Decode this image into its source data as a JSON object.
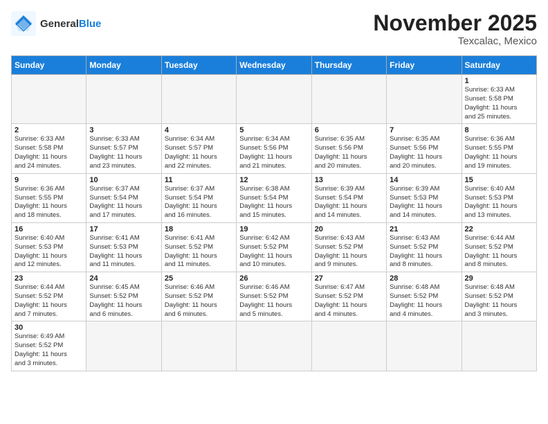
{
  "header": {
    "logo_general": "General",
    "logo_blue": "Blue",
    "title": "November 2025",
    "subtitle": "Texcalac, Mexico"
  },
  "weekdays": [
    "Sunday",
    "Monday",
    "Tuesday",
    "Wednesday",
    "Thursday",
    "Friday",
    "Saturday"
  ],
  "weeks": [
    [
      {
        "day": "",
        "info": ""
      },
      {
        "day": "",
        "info": ""
      },
      {
        "day": "",
        "info": ""
      },
      {
        "day": "",
        "info": ""
      },
      {
        "day": "",
        "info": ""
      },
      {
        "day": "",
        "info": ""
      },
      {
        "day": "1",
        "info": "Sunrise: 6:33 AM\nSunset: 5:58 PM\nDaylight: 11 hours\nand 25 minutes."
      }
    ],
    [
      {
        "day": "2",
        "info": "Sunrise: 6:33 AM\nSunset: 5:58 PM\nDaylight: 11 hours\nand 24 minutes."
      },
      {
        "day": "3",
        "info": "Sunrise: 6:33 AM\nSunset: 5:57 PM\nDaylight: 11 hours\nand 23 minutes."
      },
      {
        "day": "4",
        "info": "Sunrise: 6:34 AM\nSunset: 5:57 PM\nDaylight: 11 hours\nand 22 minutes."
      },
      {
        "day": "5",
        "info": "Sunrise: 6:34 AM\nSunset: 5:56 PM\nDaylight: 11 hours\nand 21 minutes."
      },
      {
        "day": "6",
        "info": "Sunrise: 6:35 AM\nSunset: 5:56 PM\nDaylight: 11 hours\nand 20 minutes."
      },
      {
        "day": "7",
        "info": "Sunrise: 6:35 AM\nSunset: 5:56 PM\nDaylight: 11 hours\nand 20 minutes."
      },
      {
        "day": "8",
        "info": "Sunrise: 6:36 AM\nSunset: 5:55 PM\nDaylight: 11 hours\nand 19 minutes."
      }
    ],
    [
      {
        "day": "9",
        "info": "Sunrise: 6:36 AM\nSunset: 5:55 PM\nDaylight: 11 hours\nand 18 minutes."
      },
      {
        "day": "10",
        "info": "Sunrise: 6:37 AM\nSunset: 5:54 PM\nDaylight: 11 hours\nand 17 minutes."
      },
      {
        "day": "11",
        "info": "Sunrise: 6:37 AM\nSunset: 5:54 PM\nDaylight: 11 hours\nand 16 minutes."
      },
      {
        "day": "12",
        "info": "Sunrise: 6:38 AM\nSunset: 5:54 PM\nDaylight: 11 hours\nand 15 minutes."
      },
      {
        "day": "13",
        "info": "Sunrise: 6:39 AM\nSunset: 5:54 PM\nDaylight: 11 hours\nand 14 minutes."
      },
      {
        "day": "14",
        "info": "Sunrise: 6:39 AM\nSunset: 5:53 PM\nDaylight: 11 hours\nand 14 minutes."
      },
      {
        "day": "15",
        "info": "Sunrise: 6:40 AM\nSunset: 5:53 PM\nDaylight: 11 hours\nand 13 minutes."
      }
    ],
    [
      {
        "day": "16",
        "info": "Sunrise: 6:40 AM\nSunset: 5:53 PM\nDaylight: 11 hours\nand 12 minutes."
      },
      {
        "day": "17",
        "info": "Sunrise: 6:41 AM\nSunset: 5:53 PM\nDaylight: 11 hours\nand 11 minutes."
      },
      {
        "day": "18",
        "info": "Sunrise: 6:41 AM\nSunset: 5:52 PM\nDaylight: 11 hours\nand 11 minutes."
      },
      {
        "day": "19",
        "info": "Sunrise: 6:42 AM\nSunset: 5:52 PM\nDaylight: 11 hours\nand 10 minutes."
      },
      {
        "day": "20",
        "info": "Sunrise: 6:43 AM\nSunset: 5:52 PM\nDaylight: 11 hours\nand 9 minutes."
      },
      {
        "day": "21",
        "info": "Sunrise: 6:43 AM\nSunset: 5:52 PM\nDaylight: 11 hours\nand 8 minutes."
      },
      {
        "day": "22",
        "info": "Sunrise: 6:44 AM\nSunset: 5:52 PM\nDaylight: 11 hours\nand 8 minutes."
      }
    ],
    [
      {
        "day": "23",
        "info": "Sunrise: 6:44 AM\nSunset: 5:52 PM\nDaylight: 11 hours\nand 7 minutes."
      },
      {
        "day": "24",
        "info": "Sunrise: 6:45 AM\nSunset: 5:52 PM\nDaylight: 11 hours\nand 6 minutes."
      },
      {
        "day": "25",
        "info": "Sunrise: 6:46 AM\nSunset: 5:52 PM\nDaylight: 11 hours\nand 6 minutes."
      },
      {
        "day": "26",
        "info": "Sunrise: 6:46 AM\nSunset: 5:52 PM\nDaylight: 11 hours\nand 5 minutes."
      },
      {
        "day": "27",
        "info": "Sunrise: 6:47 AM\nSunset: 5:52 PM\nDaylight: 11 hours\nand 4 minutes."
      },
      {
        "day": "28",
        "info": "Sunrise: 6:48 AM\nSunset: 5:52 PM\nDaylight: 11 hours\nand 4 minutes."
      },
      {
        "day": "29",
        "info": "Sunrise: 6:48 AM\nSunset: 5:52 PM\nDaylight: 11 hours\nand 3 minutes."
      }
    ],
    [
      {
        "day": "30",
        "info": "Sunrise: 6:49 AM\nSunset: 5:52 PM\nDaylight: 11 hours\nand 3 minutes."
      },
      {
        "day": "",
        "info": ""
      },
      {
        "day": "",
        "info": ""
      },
      {
        "day": "",
        "info": ""
      },
      {
        "day": "",
        "info": ""
      },
      {
        "day": "",
        "info": ""
      },
      {
        "day": "",
        "info": ""
      }
    ]
  ]
}
